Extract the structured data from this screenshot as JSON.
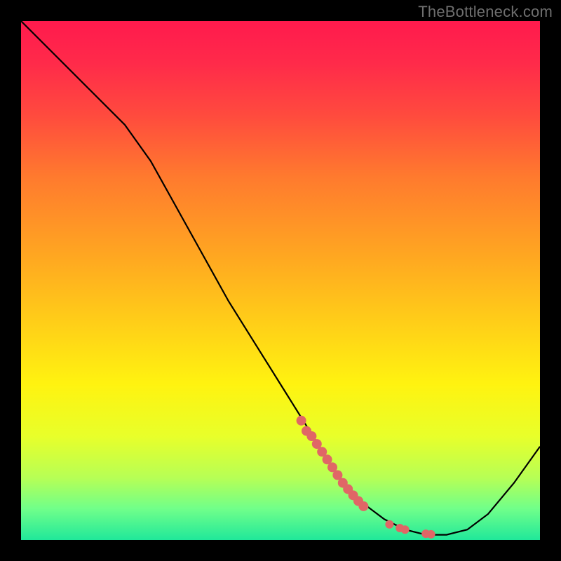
{
  "watermark": "TheBottleneck.com",
  "chart_data": {
    "type": "line",
    "title": "",
    "xlabel": "",
    "ylabel": "",
    "xlim": [
      0,
      100
    ],
    "ylim": [
      0,
      100
    ],
    "series": [
      {
        "name": "curve",
        "x": [
          0,
          5,
          10,
          15,
          20,
          25,
          30,
          35,
          40,
          45,
          50,
          55,
          60,
          63,
          66,
          70,
          74,
          78,
          82,
          86,
          90,
          95,
          100
        ],
        "y": [
          100,
          95,
          90,
          85,
          80,
          73,
          64,
          55,
          46,
          38,
          30,
          22,
          14,
          10,
          7,
          4,
          2,
          1,
          1,
          2,
          5,
          11,
          18
        ]
      }
    ],
    "highlight_points": {
      "name": "marker-band",
      "color": "#e06666",
      "points": [
        {
          "x": 54,
          "y": 23
        },
        {
          "x": 55,
          "y": 21
        },
        {
          "x": 56,
          "y": 20
        },
        {
          "x": 57,
          "y": 18.5
        },
        {
          "x": 58,
          "y": 17
        },
        {
          "x": 59,
          "y": 15.5
        },
        {
          "x": 60,
          "y": 14
        },
        {
          "x": 61,
          "y": 12.5
        },
        {
          "x": 62,
          "y": 11
        },
        {
          "x": 63,
          "y": 9.8
        },
        {
          "x": 64,
          "y": 8.6
        },
        {
          "x": 65,
          "y": 7.5
        },
        {
          "x": 66,
          "y": 6.5
        },
        {
          "x": 71,
          "y": 3.0
        },
        {
          "x": 73,
          "y": 2.3
        },
        {
          "x": 74,
          "y": 2.0
        },
        {
          "x": 78,
          "y": 1.2
        },
        {
          "x": 79,
          "y": 1.1
        }
      ]
    },
    "gradient_stops": [
      {
        "offset": 0.0,
        "color": "#ff1a4d"
      },
      {
        "offset": 0.08,
        "color": "#ff2a4a"
      },
      {
        "offset": 0.18,
        "color": "#ff4a3e"
      },
      {
        "offset": 0.3,
        "color": "#ff7a2e"
      },
      {
        "offset": 0.45,
        "color": "#ffa621"
      },
      {
        "offset": 0.6,
        "color": "#ffd417"
      },
      {
        "offset": 0.7,
        "color": "#fff310"
      },
      {
        "offset": 0.8,
        "color": "#e8ff2a"
      },
      {
        "offset": 0.88,
        "color": "#b7ff55"
      },
      {
        "offset": 0.94,
        "color": "#70ff8a"
      },
      {
        "offset": 1.0,
        "color": "#20e89a"
      }
    ]
  }
}
